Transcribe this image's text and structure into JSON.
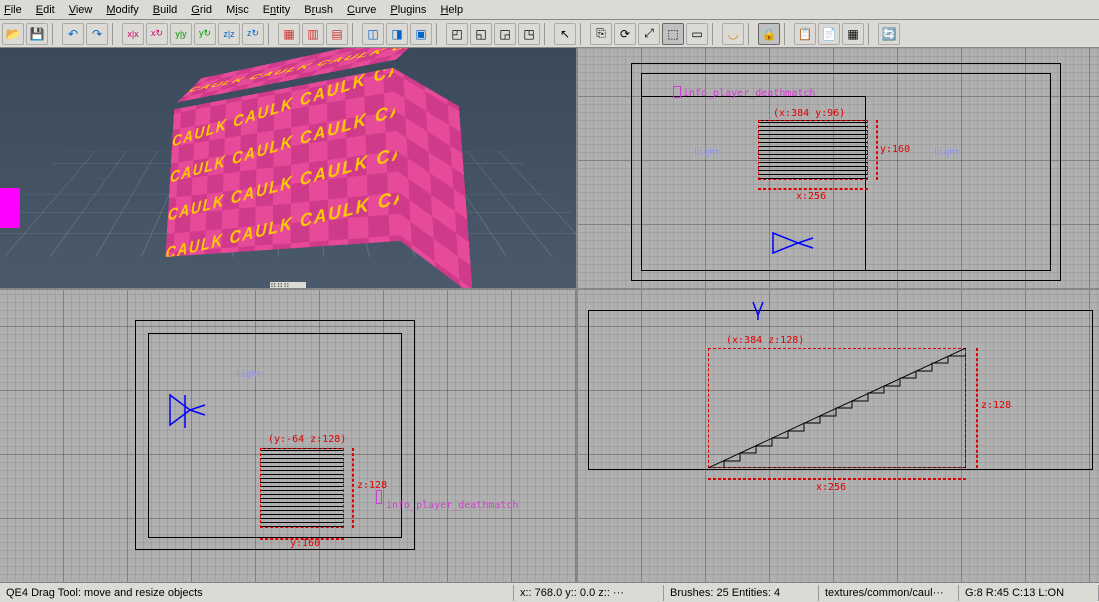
{
  "menu": {
    "file": "File",
    "edit": "Edit",
    "view": "View",
    "modify": "Modify",
    "build": "Build",
    "grid": "Grid",
    "misc": "Misc",
    "entity": "Entity",
    "brush": "Brush",
    "curve": "Curve",
    "plugins": "Plugins",
    "help": "Help"
  },
  "toolbar_icons": [
    "open",
    "save",
    "undo",
    "redo",
    "flipx",
    "rotx",
    "flipy",
    "roty",
    "flipz",
    "rotz",
    "select-complete",
    "select-touching",
    "select-inside",
    "csg-subtract",
    "csg-merge",
    "hollow",
    "clipper",
    "region-off",
    "region-xy",
    "region-brush",
    "change-views",
    "texture-lock",
    "cap",
    "entity-list",
    "surface",
    "patch",
    "console",
    "filter",
    "refresh"
  ],
  "views": {
    "tl": {
      "texture_text": "CAULK CAULK CAULK CAULK"
    },
    "tr": {
      "entity": "info_player_deathmatch",
      "coord": "(x:384  y:96)",
      "dimx": "x:256",
      "dimy": "y:160",
      "light1": "light",
      "light2": "light"
    },
    "bl": {
      "entity": "info_player_deathmatch",
      "coord": "(y:-64  z:128)",
      "dimx": "y:160",
      "dimy": "z:128",
      "light": "light"
    },
    "br": {
      "coord": "(x:384  z:128)",
      "dimx": "x:256",
      "dimy": "z:128"
    }
  },
  "status": {
    "tool": "QE4 Drag Tool: move and resize objects",
    "coords": "x::  768.0  y::      0.0  z:: ···",
    "counts": "Brushes: 25 Entities: 4",
    "texture": "textures/common/caul···",
    "grid": "G:8  R:45  C:13  L:ON"
  }
}
